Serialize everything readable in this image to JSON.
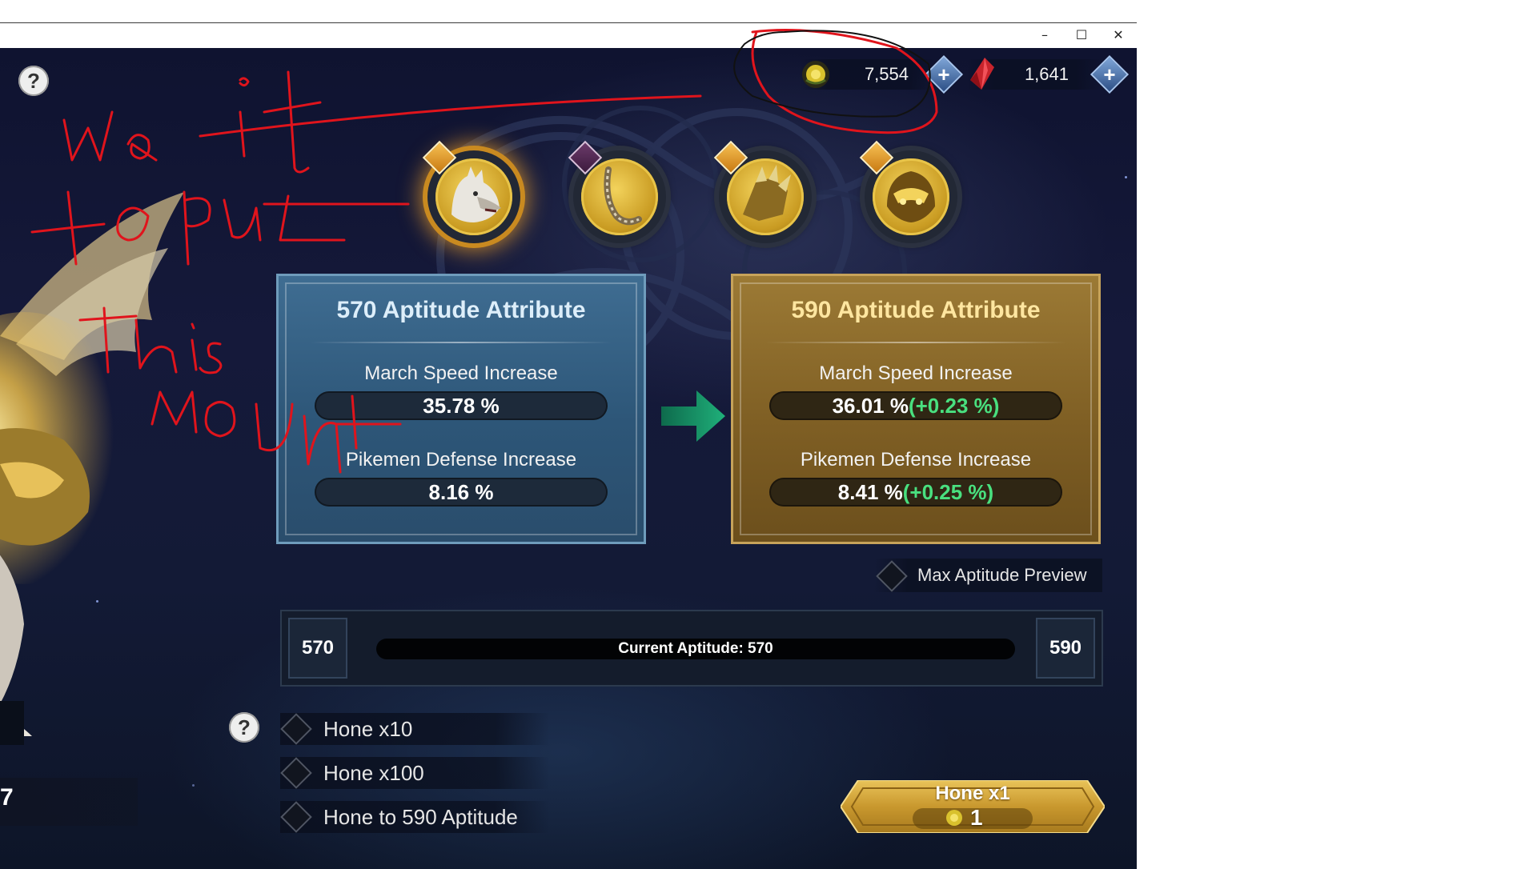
{
  "window": {
    "minimize_glyph": "–",
    "maximize_glyph": "☐",
    "close_glyph": "✕"
  },
  "currency": {
    "gold_icon": "gold-rose-coin-icon",
    "gold_value": "7,554",
    "gem_icon": "red-crystal-icon",
    "gem_value": "1,641",
    "plus_glyph": "+"
  },
  "help_glyph": "?",
  "equipment": [
    {
      "name": "wolf-mount-icon",
      "selected": true,
      "badge": "star"
    },
    {
      "name": "reins-whip-icon",
      "selected": false,
      "badge": "eye"
    },
    {
      "name": "claw-gauntlet-icon",
      "selected": false,
      "badge": "star"
    },
    {
      "name": "golden-helmet-icon",
      "selected": false,
      "badge": "star"
    }
  ],
  "current_panel": {
    "title": "570 Aptitude Attribute",
    "stat1_label": "March Speed Increase",
    "stat1_value": "35.78 %",
    "stat2_label": "Pikemen Defense Increase",
    "stat2_value": "8.16 %"
  },
  "next_panel": {
    "title": "590 Aptitude Attribute",
    "stat1_label": "March Speed Increase",
    "stat1_value": "36.01 %",
    "stat1_inc": "(+0.23 %)",
    "stat2_label": "Pikemen Defense Increase",
    "stat2_value": "8.41 %",
    "stat2_inc": "(+0.25 %)"
  },
  "max_preview_label": "Max Aptitude Preview",
  "aptitude": {
    "min": "570",
    "max": "590",
    "label": "Current Aptitude: 570",
    "progress": 0
  },
  "hone_options": [
    {
      "label": "Hone x10"
    },
    {
      "label": "Hone x100"
    },
    {
      "label": "Hone to 590 Aptitude"
    }
  ],
  "hone_button": {
    "label": "Hone x1",
    "cost": "1"
  },
  "left_partial_text": "7",
  "colors": {
    "increase_green": "#49e07f",
    "annotation_red": "#e0141c",
    "annotation_black": "#111111"
  }
}
